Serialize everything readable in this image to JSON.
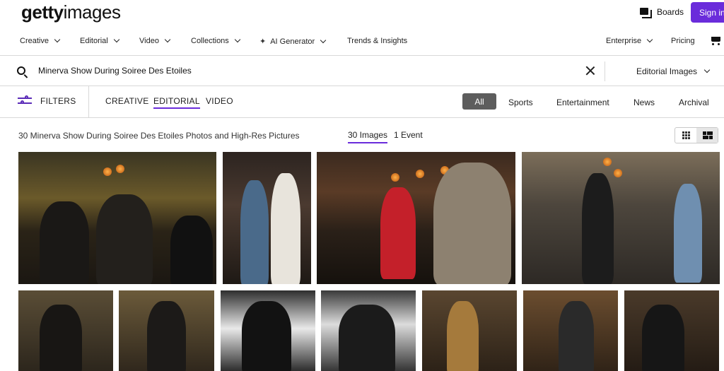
{
  "header": {
    "logo_bold": "getty",
    "logo_rest": "images",
    "boards_label": "Boards",
    "signin_label": "Sign in"
  },
  "nav": {
    "items": [
      "Creative",
      "Editorial",
      "Video",
      "Collections",
      "AI Generator",
      "Trends & Insights"
    ],
    "right": [
      "Enterprise",
      "Pricing"
    ],
    "cart_icon": "cart-icon"
  },
  "search": {
    "value": "Minerva Show During Soiree Des Etoiles",
    "scope": "Editorial Images"
  },
  "filters": {
    "label": "FILTERS",
    "content_types": [
      "CREATIVE",
      "EDITORIAL",
      "VIDEO"
    ],
    "active_content_type": "EDITORIAL",
    "categories": [
      "All",
      "Sports",
      "Entertainment",
      "News",
      "Archival"
    ],
    "active_category": "All",
    "accent": "#6a2cdb"
  },
  "results": {
    "title": "30 Minerva Show During Soiree Des Etoiles Photos and High-Res Pictures",
    "tab_images": "30 Images",
    "tab_events": "1 Event"
  },
  "photos": [
    {
      "name": "photo-1"
    },
    {
      "name": "photo-2"
    },
    {
      "name": "photo-3"
    },
    {
      "name": "photo-4"
    },
    {
      "name": "photo-5"
    },
    {
      "name": "photo-6"
    },
    {
      "name": "photo-7"
    },
    {
      "name": "photo-8"
    },
    {
      "name": "photo-9"
    },
    {
      "name": "photo-10"
    },
    {
      "name": "photo-11"
    }
  ]
}
